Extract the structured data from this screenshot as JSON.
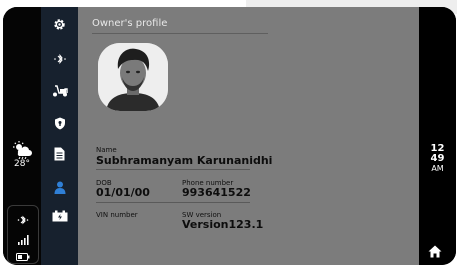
{
  "weather": {
    "temperature": "28°",
    "icon": "cloud-rain-sun-icon"
  },
  "status": {
    "icons": [
      "bluetooth-icon",
      "signal-bars-icon",
      "battery-icon"
    ]
  },
  "nav": {
    "items": [
      {
        "name": "settings",
        "icon": "gear-icon",
        "active": false
      },
      {
        "name": "bluetooth",
        "icon": "bluetooth-icon",
        "active": false
      },
      {
        "name": "scooter",
        "icon": "scooter-icon",
        "active": false
      },
      {
        "name": "security",
        "icon": "shield-icon",
        "active": false
      },
      {
        "name": "documents",
        "icon": "document-icon",
        "active": false
      },
      {
        "name": "profile",
        "icon": "user-icon",
        "active": true
      },
      {
        "name": "battery",
        "icon": "charging-battery-icon",
        "active": false
      }
    ],
    "active_color": "#2f7fd6"
  },
  "profile": {
    "title": "Owner's profile",
    "name_label": "Name",
    "name_value": "Subhramanyam  Karunanidhi",
    "dob_label": "DOB",
    "dob_value": "01/01/00",
    "phone_label": "Phone number",
    "phone_value": "993641522",
    "vin_label": "VIN number",
    "vin_value": "",
    "sw_label": "SW version",
    "sw_value": "Version123.1"
  },
  "clock": {
    "hour": "12",
    "minute": "49",
    "ampm": "AM"
  },
  "home": {
    "icon": "home-icon"
  }
}
